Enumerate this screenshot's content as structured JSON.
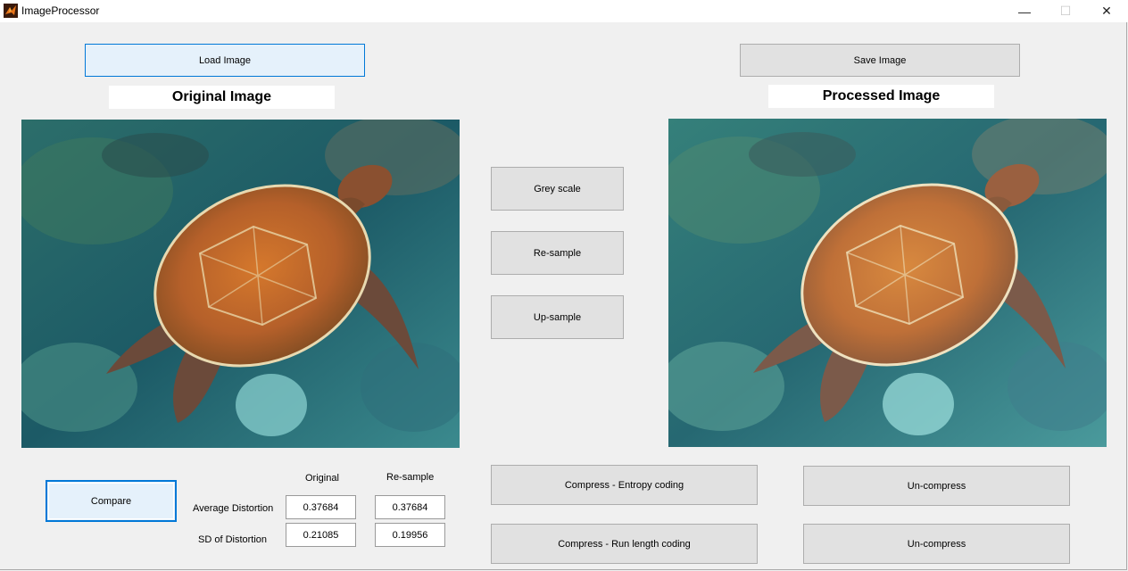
{
  "window": {
    "title": "ImageProcessor",
    "minimize": "—",
    "maximize": "☐",
    "close": "✕"
  },
  "buttons": {
    "load": "Load Image",
    "save": "Save Image",
    "grey": "Grey scale",
    "resample": "Re-sample",
    "upsample": "Up-sample",
    "compare": "Compare",
    "compress_entropy": "Compress - Entropy coding",
    "compress_rle": "Compress - Run length coding",
    "uncompress_1": "Un-compress",
    "uncompress_2": "Un-compress"
  },
  "labels": {
    "original_image": "Original Image",
    "processed_image": "Processed Image"
  },
  "stats": {
    "col_original": "Original",
    "col_resample": "Re-sample",
    "row_avg": "Average Distortion",
    "row_sd": "SD of Distortion",
    "avg_original": "0.37684",
    "avg_resample": "0.37684",
    "sd_original": "0.21085",
    "sd_resample": "0.19956"
  },
  "colors": {
    "accent": "#0078d7",
    "button_bg": "#e1e1e1",
    "window_bg": "#f0f0f0"
  }
}
